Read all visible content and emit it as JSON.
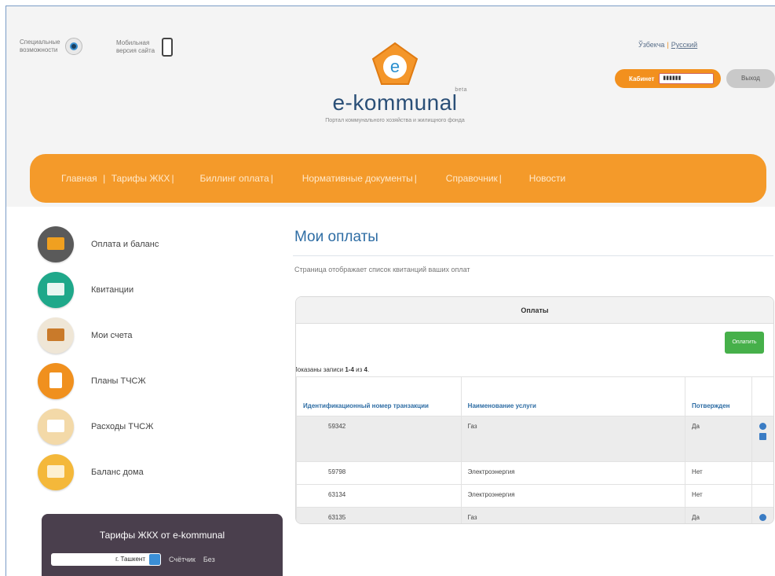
{
  "header": {
    "accessibility_label": "Специальные возможности",
    "mobile_label": "Мобильная версия сайта",
    "logo_name": "e-kommunal",
    "logo_beta": "beta",
    "logo_subtitle": "Портал коммунального хозяйства и жилищного фонда",
    "lang_uz": "Ўзбекча",
    "lang_ru": "Русский",
    "cabinet_label": "Кабинет",
    "cabinet_value": "▮▮▮▮▮▮",
    "logout_label": "Выход"
  },
  "nav": [
    "Главная",
    "Тарифы ЖКХ",
    "Биллинг оплата",
    "Нормативные документы",
    "Справочник",
    "Новости"
  ],
  "sidebar": {
    "items": [
      {
        "label": "Оплата и баланс",
        "icon": "wallet-icon"
      },
      {
        "label": "Квитанции",
        "icon": "receipt-icon"
      },
      {
        "label": "Мои счета",
        "icon": "folders-icon"
      },
      {
        "label": "Планы ТЧСЖ",
        "icon": "clipboard-icon"
      },
      {
        "label": "Расходы ТЧСЖ",
        "icon": "tray-icon"
      },
      {
        "label": "Баланс дома",
        "icon": "house-icon"
      }
    ],
    "tariffs_title": "Тарифы ЖКХ от e-kommunal",
    "city_select": "г. Ташкент",
    "col_meter": "Счётчик",
    "col_without": "Без"
  },
  "main": {
    "title": "Мои оплаты",
    "description": "Страница отображает список квитанций ваших оплат",
    "panel_title": "Оплаты",
    "pay_button": "Оплатить",
    "shown_prefix": "Показаны записи ",
    "shown_range": "1-4",
    "shown_mid": " из ",
    "shown_total": "4",
    "shown_suffix": ".",
    "columns": [
      "Идентификационный номер транзакции",
      "Наименование услуги",
      "Потвержден"
    ],
    "rows": [
      {
        "id": "59342",
        "service": "Газ",
        "confirmed": "Да",
        "actions": true
      },
      {
        "id": "59798",
        "service": "Электроэнергия",
        "confirmed": "Нет",
        "actions": false
      },
      {
        "id": "63134",
        "service": "Электроэнергия",
        "confirmed": "Нет",
        "actions": false
      },
      {
        "id": "63135",
        "service": "Газ",
        "confirmed": "Да",
        "actions": true
      }
    ]
  },
  "colors": {
    "accent": "#f49a2a",
    "title_blue": "#2e6da4",
    "button_green": "#46b04a"
  }
}
